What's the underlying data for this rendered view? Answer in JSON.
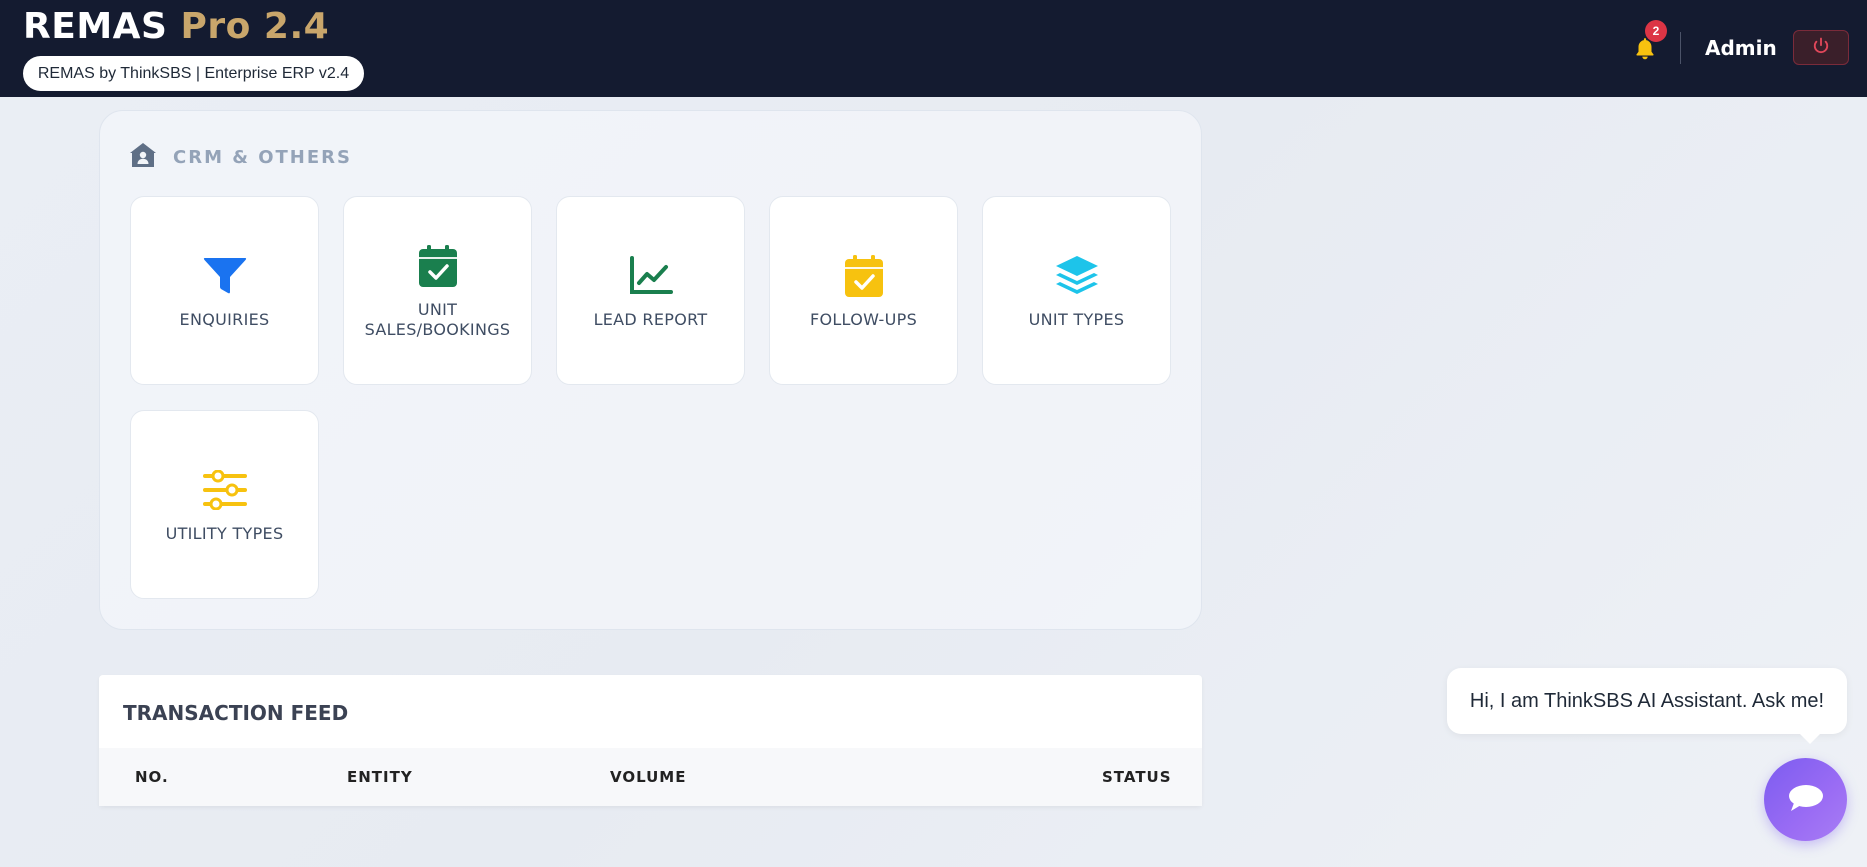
{
  "header": {
    "brand_main": "REMAS",
    "brand_accent": "Pro 2.4",
    "subtitle": "REMAS by ThinkSBS | Enterprise ERP v2.4",
    "notification_count": "2",
    "user_name": "Admin",
    "icons": {
      "notifications": "bell-icon",
      "logout": "power-icon"
    },
    "colors": {
      "background": "#141b30",
      "brand_accent": "#c9a66b",
      "badge": "#dc3545"
    }
  },
  "crm": {
    "title": "CRM & OTHERS",
    "icon": "house-user-icon",
    "tiles": [
      {
        "label": "ENQUIRIES",
        "icon": "funnel-icon",
        "color": "#1a73f0"
      },
      {
        "label": "UNIT SALES/BOOKINGS",
        "icon": "calendar-check-icon",
        "color": "#1a7f4e"
      },
      {
        "label": "LEAD REPORT",
        "icon": "line-chart-icon",
        "color": "#1a7f4e"
      },
      {
        "label": "FOLLOW-UPS",
        "icon": "calendar-check-icon",
        "color": "#f7c20f"
      },
      {
        "label": "UNIT TYPES",
        "icon": "layers-icon",
        "color": "#1dc4ea"
      },
      {
        "label": "UTILITY TYPES",
        "icon": "sliders-icon",
        "color": "#f7c20f"
      }
    ]
  },
  "feed": {
    "title": "TRANSACTION FEED",
    "columns": [
      "NO.",
      "ENTITY",
      "VOLUME",
      "STATUS"
    ]
  },
  "assistant": {
    "message": "Hi, I am ThinkSBS AI Assistant. Ask me!",
    "icon": "chat-bubble-icon",
    "color": "#8b63f2"
  }
}
